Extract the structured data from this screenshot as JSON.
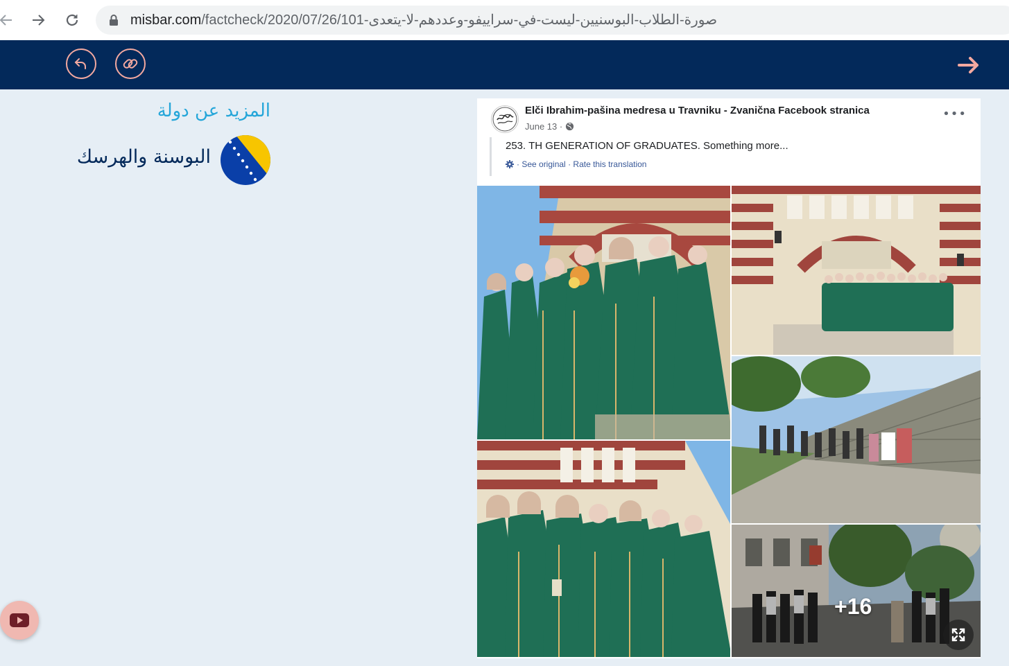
{
  "browser": {
    "url_host": "misbar.com",
    "url_path": "/factcheck/2020/07/26/101-صورة-الطلاب-البوسنيين-ليست-في-سراييفو-وعددهم-لا-يتعدى"
  },
  "header": {
    "accent_color": "#f4a9a0",
    "background_color": "#03295a"
  },
  "sidebar": {
    "more_title": "المزيد عن دولة",
    "country_name": "البوسنة والهرسك"
  },
  "fb_post": {
    "page_name": "Elči Ibrahim-pašina medresa u Travniku - Zvanična Facebook stranica",
    "date": "June 13 ·",
    "text": "253. TH GENERATION OF GRADUATES. Something more...",
    "see_original": "· See original",
    "separator": "·",
    "rate_translation": "Rate this translation",
    "more_photos": "+16"
  }
}
